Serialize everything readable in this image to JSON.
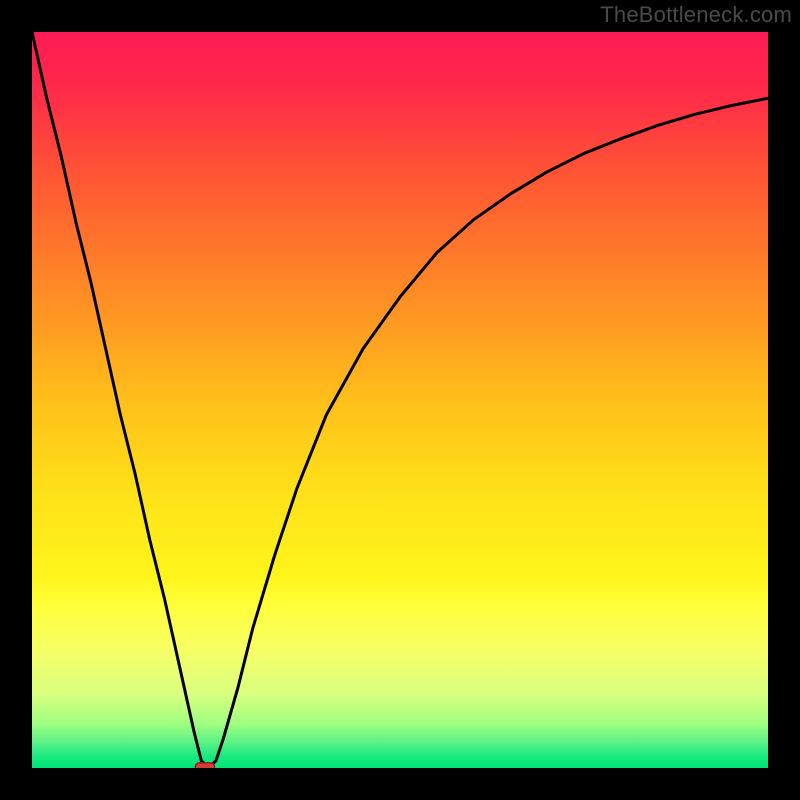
{
  "watermark": "TheBottleneck.com",
  "chart_data": {
    "type": "line",
    "title": "",
    "xlabel": "",
    "ylabel": "",
    "xlim": [
      0,
      100
    ],
    "ylim": [
      0,
      100
    ],
    "grid": false,
    "gradient_stops": [
      {
        "offset": 0.0,
        "color": "#ff1a55"
      },
      {
        "offset": 0.08,
        "color": "#ff2a49"
      },
      {
        "offset": 0.2,
        "color": "#ff5733"
      },
      {
        "offset": 0.35,
        "color": "#ff8a26"
      },
      {
        "offset": 0.5,
        "color": "#ffbf1a"
      },
      {
        "offset": 0.62,
        "color": "#ffe019"
      },
      {
        "offset": 0.74,
        "color": "#fff51a"
      },
      {
        "offset": 0.78,
        "color": "#ffff3a"
      },
      {
        "offset": 0.84,
        "color": "#f6ff66"
      },
      {
        "offset": 0.9,
        "color": "#d9ff80"
      },
      {
        "offset": 0.94,
        "color": "#9fff80"
      },
      {
        "offset": 0.965,
        "color": "#5cf286"
      },
      {
        "offset": 0.985,
        "color": "#17e880"
      },
      {
        "offset": 1.0,
        "color": "#00e676"
      }
    ],
    "series": [
      {
        "name": "bottleneck-curve",
        "color": "#000000",
        "x": [
          0,
          2,
          4,
          6,
          8,
          10,
          12,
          14,
          16,
          18,
          20,
          22,
          23,
          24,
          25,
          26,
          28,
          30,
          33,
          36,
          40,
          45,
          50,
          55,
          60,
          65,
          70,
          75,
          80,
          85,
          90,
          95,
          100
        ],
        "y": [
          100,
          91,
          83,
          74,
          66,
          57,
          48,
          40,
          31,
          23,
          14,
          5,
          1,
          0,
          1,
          4,
          11,
          19,
          29,
          38,
          48,
          57,
          64,
          70,
          74.5,
          78,
          81,
          83.5,
          85.5,
          87.3,
          88.8,
          90,
          91
        ]
      }
    ],
    "marker": {
      "shape": "rounded-rect",
      "x": 23.5,
      "y": 0,
      "width": 2.6,
      "height": 1.4,
      "fill": "#d83b3b",
      "stroke": "#8f1f1f"
    }
  }
}
